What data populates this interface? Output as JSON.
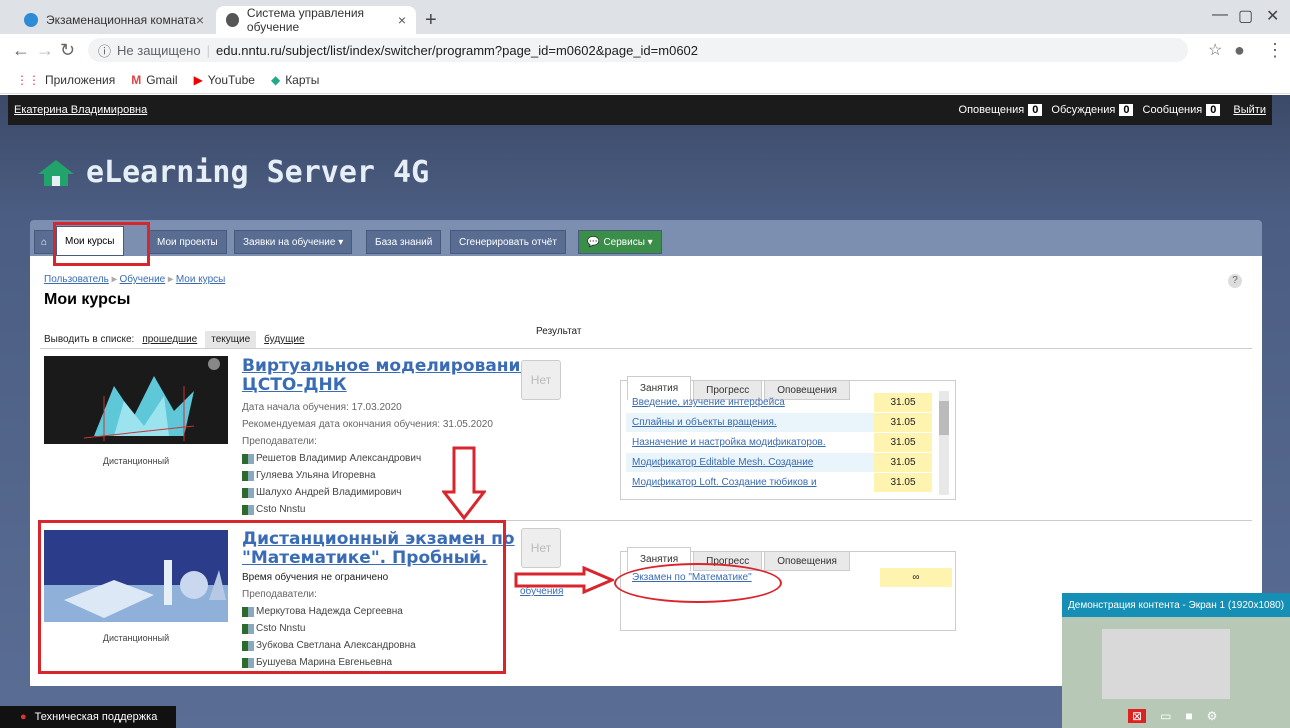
{
  "browser": {
    "tabs": [
      {
        "title": "Экзаменационная комната"
      },
      {
        "title": "Система управления обучение"
      }
    ],
    "address": {
      "security": "Не защищено",
      "url": "edu.nntu.ru/subject/list/index/switcher/programm?page_id=m0602&page_id=m0602"
    },
    "bookmarks": [
      "Приложения",
      "Gmail",
      "YouTube",
      "Карты"
    ]
  },
  "topbar": {
    "user": "Екатерина Владимировна",
    "notifications_label": "Оповещения",
    "notifications_count": "0",
    "discussions_label": "Обсуждения",
    "discussions_count": "0",
    "messages_label": "Сообщения",
    "messages_count": "0",
    "logout": "Выйти"
  },
  "logo": {
    "text": "eLearning Server 4G"
  },
  "nav": {
    "tabs": [
      "Мои курсы",
      "Мои проекты",
      "Заявки на обучение ▾",
      "База знаний",
      "Сгенерировать отчёт",
      "Сервисы ▾"
    ]
  },
  "breadcrumb": [
    "Пользователь",
    "Обучение",
    "Мои курсы"
  ],
  "page_title": "Мои курсы",
  "filter": {
    "label": "Выводить в списке:",
    "past": "прошедшие",
    "current": "текущие",
    "future": "будущие"
  },
  "result_label": "Результат",
  "courses": [
    {
      "title_line1": "Виртуальное моделирование",
      "title_line2": "ЦСТО-ДНК",
      "start": "Дата начала обучения: 17.03.2020",
      "end": "Рекомендуемая дата окончания обучения: 31.05.2020",
      "teachers_label": "Преподаватели:",
      "teachers": [
        "Решетов Владимир Александрович",
        "Гуляева Ульяна Игоревна",
        "Шалухо Андрей Владимирович",
        "Csto Nnstu"
      ],
      "kind": "Дистанционный",
      "result": "Нет",
      "panel_tabs": [
        "Занятия",
        "Прогресс",
        "Оповещения"
      ],
      "lessons": [
        {
          "name": "Введение, изучение интерфейса",
          "date": "31.05"
        },
        {
          "name": "Сплайны и объекты вращения.",
          "date": "31.05"
        },
        {
          "name": "Назначение и настройка модификаторов.",
          "date": "31.05"
        },
        {
          "name": "Модификатор Editable Mesh. Создание",
          "date": "31.05"
        },
        {
          "name": "Модификатор Loft. Создание тюбиков и",
          "date": "31.05"
        }
      ]
    },
    {
      "title_line1": "Дистанционный экзамен по",
      "title_line2": "\"Математике\". Пробный.",
      "time": "Время обучения не ограничено",
      "teachers_label": "Преподаватели:",
      "teachers": [
        "Меркутова Надежда Сергеевна",
        "Csto Nnstu",
        "Зубкова Светлана Александровна",
        "Бушуева Марина Евгеньевна"
      ],
      "kind": "Дистанционный",
      "result": "Нет",
      "unsub": "обучения",
      "panel_tabs": [
        "Занятия",
        "Прогресс",
        "Оповещения"
      ],
      "lessons": [
        {
          "name": "Экзамен по \"Математике\"",
          "date": "∞"
        }
      ]
    }
  ],
  "support": "Техническая поддержка",
  "demo_title": "Демонстрация контента - Экран 1 (1920x1080)",
  "colors": {
    "accent": "#3a6cb5",
    "annotation": "#d8262c"
  }
}
